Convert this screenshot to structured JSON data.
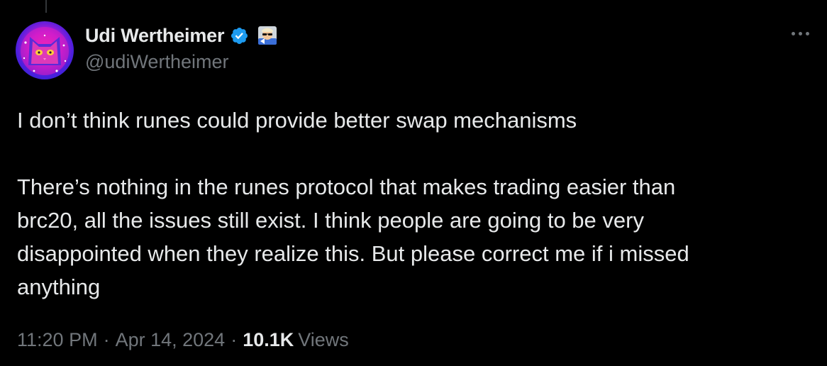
{
  "tweet": {
    "author": {
      "display_name": "Udi Wertheimer",
      "handle": "@udiWertheimer",
      "verified": true,
      "avatar_icon": "cat-avatar-icon",
      "badge_icon": "sunglasses-emoji-badge-icon"
    },
    "more_icon": "more-options-icon",
    "text": {
      "paragraph1": "I don’t think runes could provide better swap mechanisms",
      "paragraph2_line1": "There’s nothing in the runes protocol that makes trading easier than",
      "paragraph2_line2": "brc20, all the issues still exist. I think people are going to be very",
      "paragraph2_line3": "disappointed when they realize this. But please correct me if i missed",
      "paragraph2_line4": "anything"
    },
    "meta": {
      "time": "11:20 PM",
      "separator": "·",
      "date": "Apr 14, 2024",
      "views_count": "10.1K",
      "views_label": "Views"
    }
  },
  "colors": {
    "background": "#000000",
    "text_primary": "#e7e9ea",
    "text_secondary": "#71767b",
    "verified_blue": "#1d9bf0"
  }
}
